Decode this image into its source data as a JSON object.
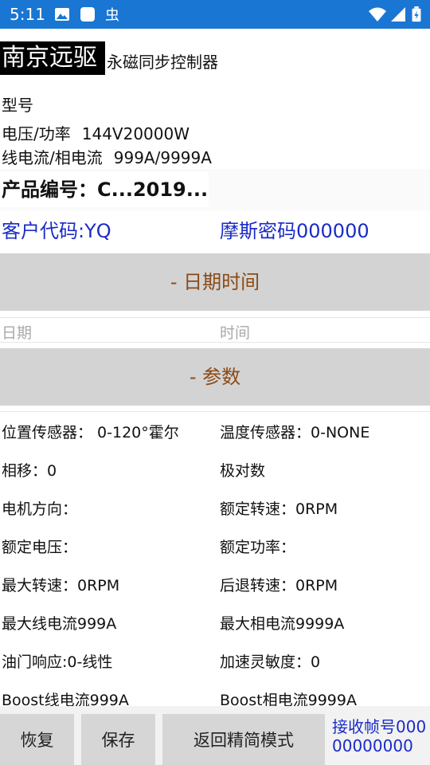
{
  "status_bar": {
    "time": "5:11",
    "icons": [
      "image-icon",
      "square-app-icon",
      "bug-icon",
      "wifi-icon",
      "signal-icon",
      "battery-charging-icon"
    ],
    "background": "#1976d2"
  },
  "brand": {
    "name": "南京远驱",
    "subtitle": "永磁同步控制器"
  },
  "model": {
    "label": "型号"
  },
  "specs": {
    "voltage_power_label": "电压/功率",
    "voltage_power_value": "144V20000W",
    "current_label": "线电流/相电流",
    "current_value": "999A/9999A"
  },
  "product": {
    "label": "产品编号：C...2019..."
  },
  "customer": {
    "code": "客户代码:YQ",
    "morse": "摩斯密码000000"
  },
  "datetime_section": {
    "title": "- 日期时间",
    "date_placeholder": "日期",
    "time_placeholder": "时间"
  },
  "params_section": {
    "title": "- 参数",
    "left": [
      "位置传感器：  0-120°霍尔",
      "相移：0",
      "电机方向：",
      "额定电压：",
      "最大转速：0RPM",
      "最大线电流999A",
      "油门响应:0-线性",
      "Boost线电流999A"
    ],
    "right": [
      "温度传感器：0-NONE",
      "极对数",
      "额定转速：0RPM",
      "额定功率：",
      "后退转速：0RPM",
      "最大相电流9999A",
      "加速灵敏度：0",
      "Boost相电流9999A"
    ]
  },
  "bottom": {
    "restore": "恢复",
    "save": "保存",
    "simple_mode": "返回精简模式",
    "receive_frame": "接收帧号00000000000"
  },
  "colors": {
    "accent_blue": "#1a2bc6",
    "section_text": "#8b4a16",
    "section_bg": "#d3d3d3"
  }
}
